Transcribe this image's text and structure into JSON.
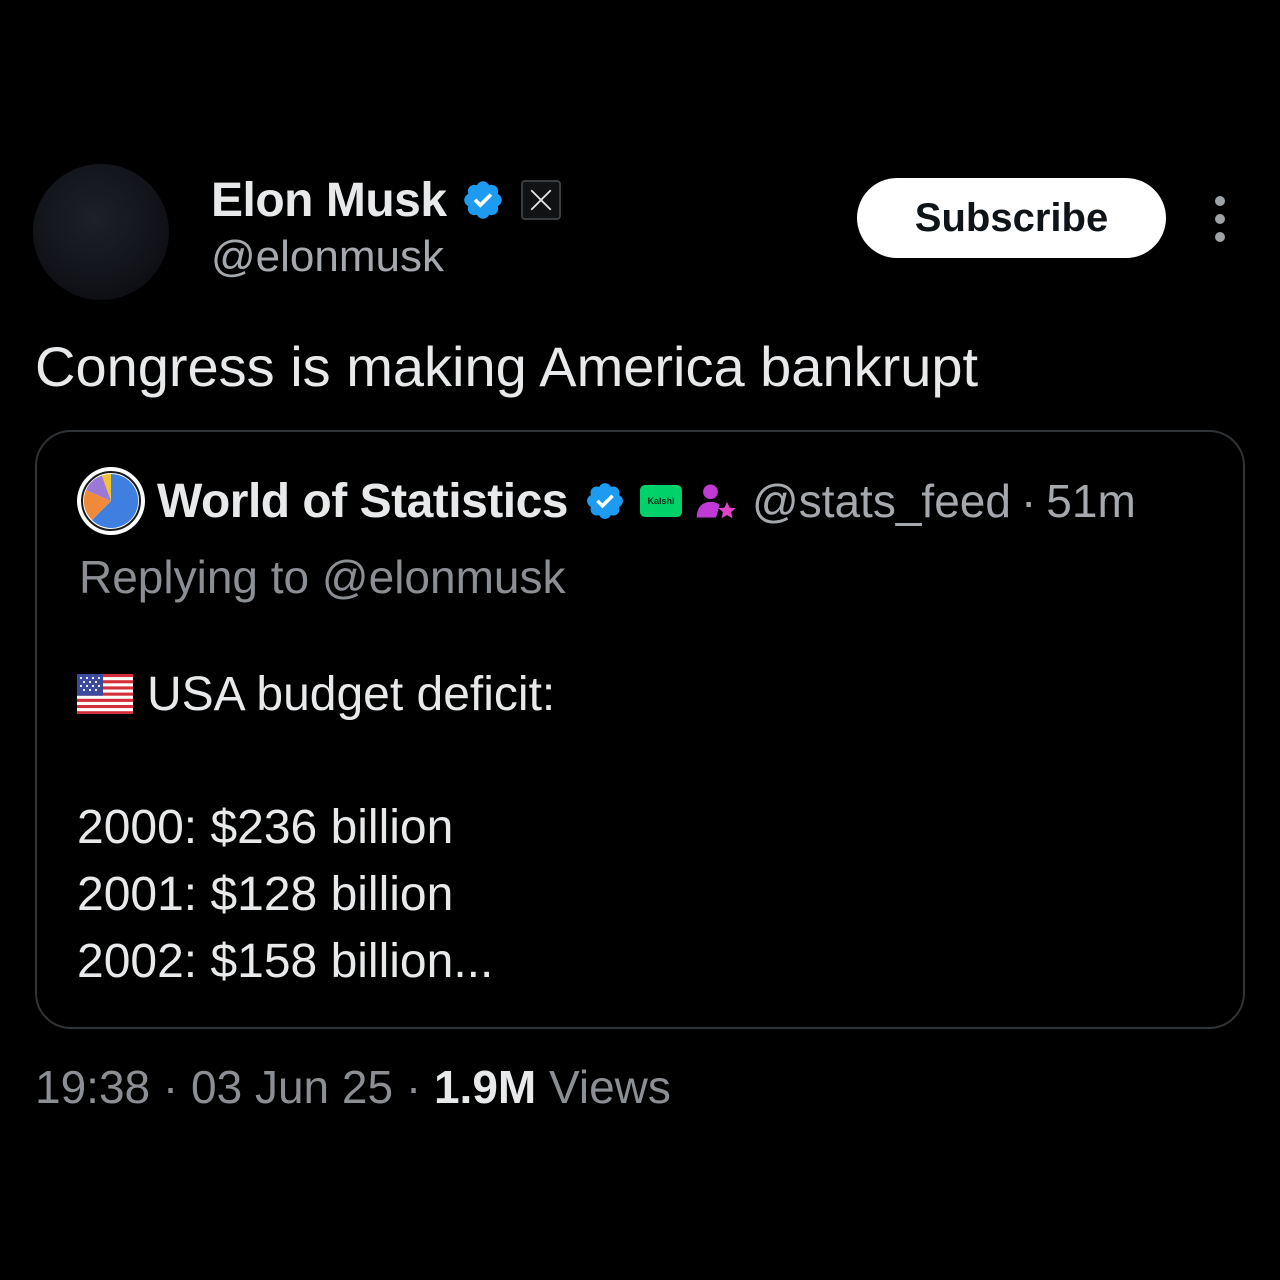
{
  "author": {
    "display_name": "Elon Musk",
    "handle": "@elonmusk",
    "verified_icon": "verified-badge-icon",
    "affiliation_icon": "x-logo-icon"
  },
  "actions": {
    "subscribe_label": "Subscribe",
    "more_icon": "more-vertical-icon"
  },
  "tweet": {
    "text": "Congress is making America bankrupt"
  },
  "quoted": {
    "display_name": "World of Statistics",
    "handle": "@stats_feed",
    "separator": "·",
    "time": "51m",
    "badge_text": "Kalshi",
    "replying_to": "Replying to @elonmusk",
    "title": "USA budget deficit:",
    "lines": [
      "2000: $236 billion",
      "2001: $128 billion",
      "2002: $158 billion..."
    ],
    "avatar_icon": "pie-chart-icon",
    "flag_icon": "us-flag-icon",
    "person_icon": "person-star-icon"
  },
  "meta": {
    "time": "19:38",
    "sep1": "·",
    "date": "03 Jun 25",
    "sep2": "·",
    "views_count": "1.9M",
    "views_label": "Views"
  },
  "colors": {
    "background": "#000000",
    "text_primary": "#e7e9ea",
    "text_secondary": "#8b8f94",
    "verified_blue": "#1d9bf0",
    "kalshi_green": "#00d26a",
    "border": "#2f3336"
  }
}
